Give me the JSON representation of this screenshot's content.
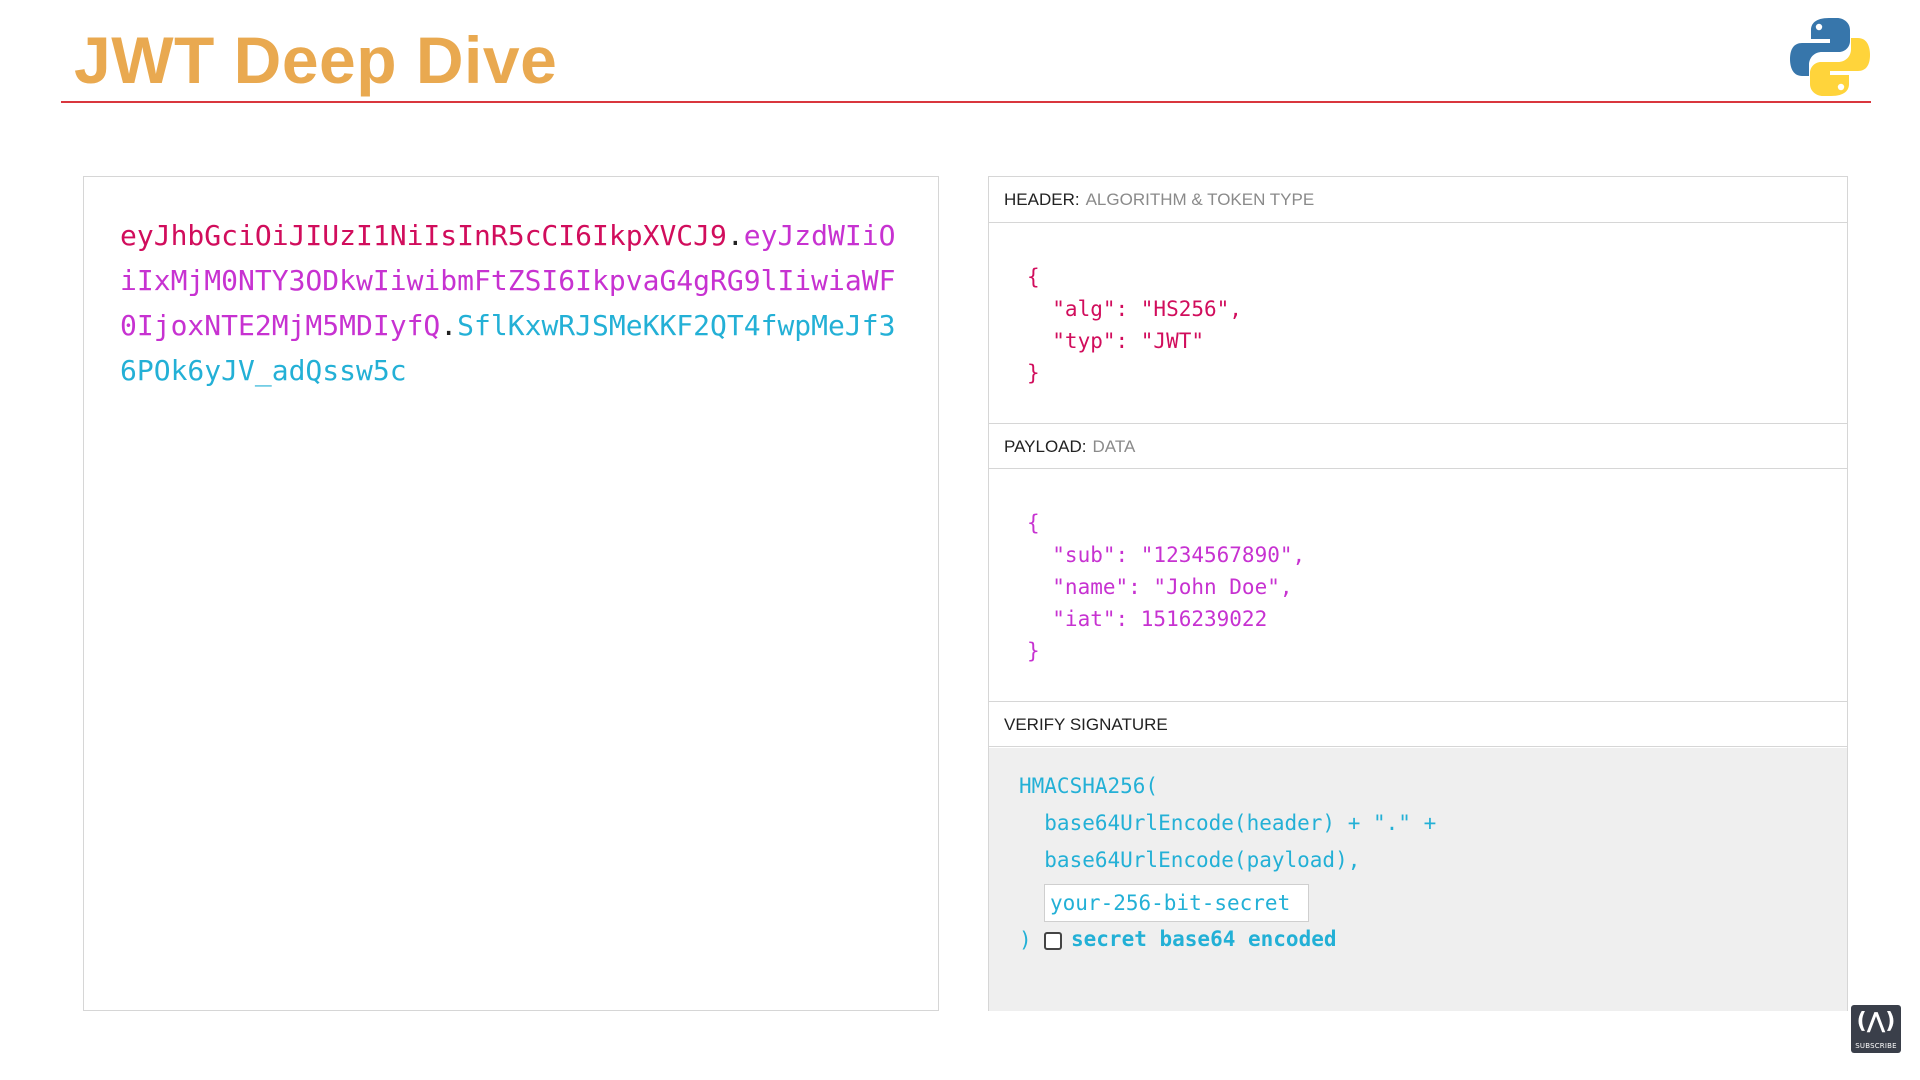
{
  "slide": {
    "title": "JWT Deep Dive",
    "title_color": "#E9A950",
    "rule_color": "#D9363E"
  },
  "encoded": {
    "header_part": "eyJhbGciOiJIUzI1NiIsInR5cCI6IkpXVCJ9",
    "payload_part": "eyJzdWIiOiIxMjM0NTY3ODkwIiwibmFtZSI6IkpvaG4gRG9lIiwiaWF0IjoxNTE2MjM5MDIyfQ",
    "signature_part": "SflKxwRJSMeKKF2QT4fwpMeJf36POk6yJV_adQssw5c",
    "separator": ".",
    "colors": {
      "header": "#D10D5C",
      "payload": "#C732D1",
      "signature": "#23B0D6"
    }
  },
  "decoded": {
    "header_section": {
      "title": "HEADER:",
      "subtitle": "ALGORITHM & TOKEN TYPE"
    },
    "header_json": "{\n  \"alg\": \"HS256\",\n  \"typ\": \"JWT\"\n}",
    "payload_section": {
      "title": "PAYLOAD:",
      "subtitle": "DATA"
    },
    "payload_json": "{\n  \"sub\": \"1234567890\",\n  \"name\": \"John Doe\",\n  \"iat\": 1516239022\n}",
    "verify_section": {
      "title": "VERIFY SIGNATURE"
    },
    "signature_code": "HMACSHA256(\n  base64UrlEncode(header) + \".\" +\n  base64UrlEncode(payload),",
    "secret_placeholder": "your-256-bit-secret",
    "close_paren": ")",
    "base64_checkbox_label": "secret base64 encoded",
    "base64_checked": false
  },
  "badge": {
    "label": "SUBSCRIBE",
    "icon": "freecodecamp-icon"
  },
  "logo": {
    "icon": "python-logo-icon"
  }
}
